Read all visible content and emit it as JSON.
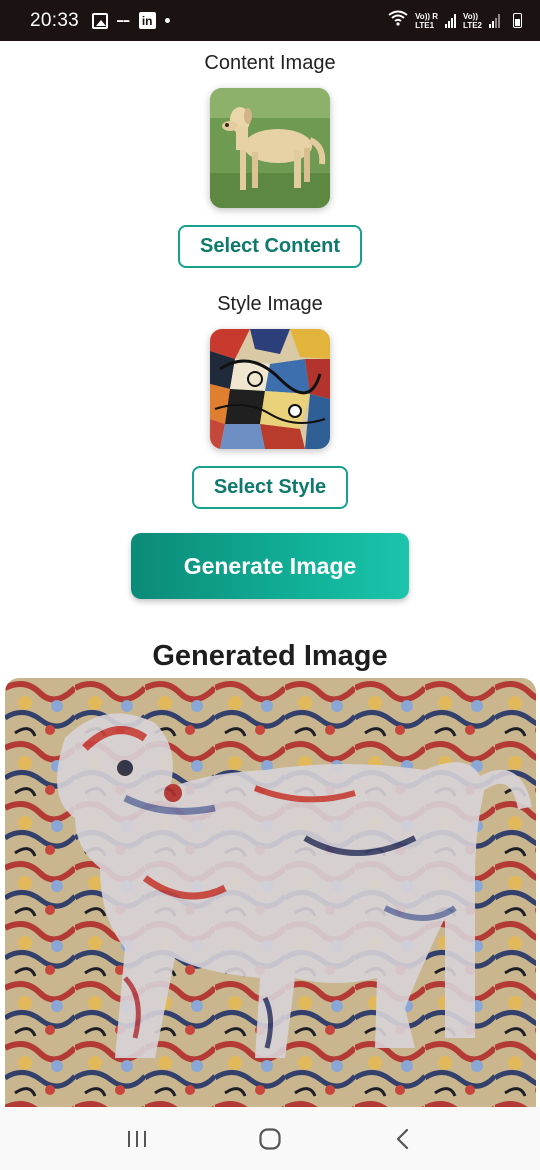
{
  "status_bar": {
    "time": "20:33",
    "linkedin_icon_text": "in",
    "lte1": "Vo)) R\nLTE1",
    "lte1_top": "Vo)) R",
    "lte1_bottom": "LTE1",
    "lte2_top": "Vo))",
    "lte2_bottom": "LTE2"
  },
  "content_section": {
    "label": "Content Image",
    "button_label": "Select Content"
  },
  "style_section": {
    "label": "Style Image",
    "button_label": "Select Style"
  },
  "generate_button_label": "Generate Image",
  "result": {
    "title": "Generated Image"
  },
  "icons": {
    "recents": "recents-icon",
    "home": "home-icon",
    "back": "back-icon"
  },
  "colors": {
    "accent": "#17a08c",
    "accent_text": "#0d7a6b",
    "status_bar_bg": "#1b1212"
  }
}
